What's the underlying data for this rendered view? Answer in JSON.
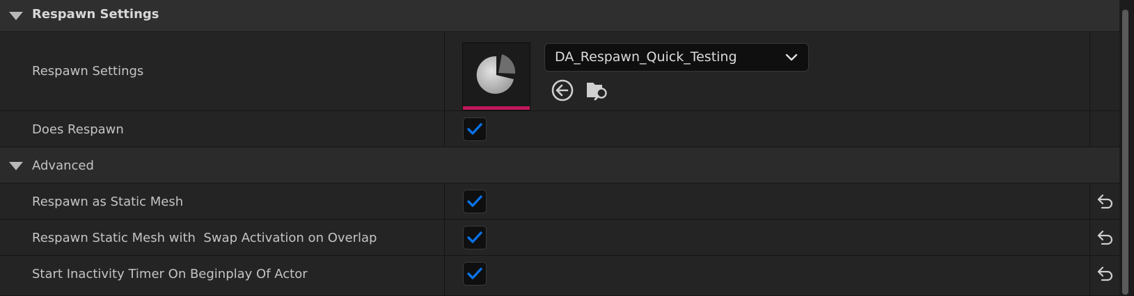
{
  "section": {
    "title": "Respawn Settings"
  },
  "rows": {
    "respawn_settings": {
      "label": "Respawn Settings",
      "asset_value": "DA_Respawn_Quick_Testing"
    },
    "does_respawn": {
      "label": "Does Respawn",
      "checked": true
    },
    "advanced": {
      "label": "Advanced"
    },
    "respawn_static_mesh": {
      "label": "Respawn as Static Mesh",
      "checked": true
    },
    "respawn_swap_activation": {
      "label": "Respawn Static Mesh with  Swap Activation on Overlap",
      "checked": true
    },
    "inactivity_timer": {
      "label": "Start Inactivity Timer On Beginplay Of Actor",
      "checked": true
    }
  },
  "colors": {
    "accent": "#0a72e8",
    "asset_bar": "#c2185b",
    "background": "#242424"
  },
  "icons": [
    "expand-triangle-icon",
    "data-asset-thumbnail-icon",
    "chevron-down-icon",
    "use-selected-asset-icon",
    "browse-asset-icon",
    "checkmark-icon",
    "reset-to-default-icon"
  ]
}
